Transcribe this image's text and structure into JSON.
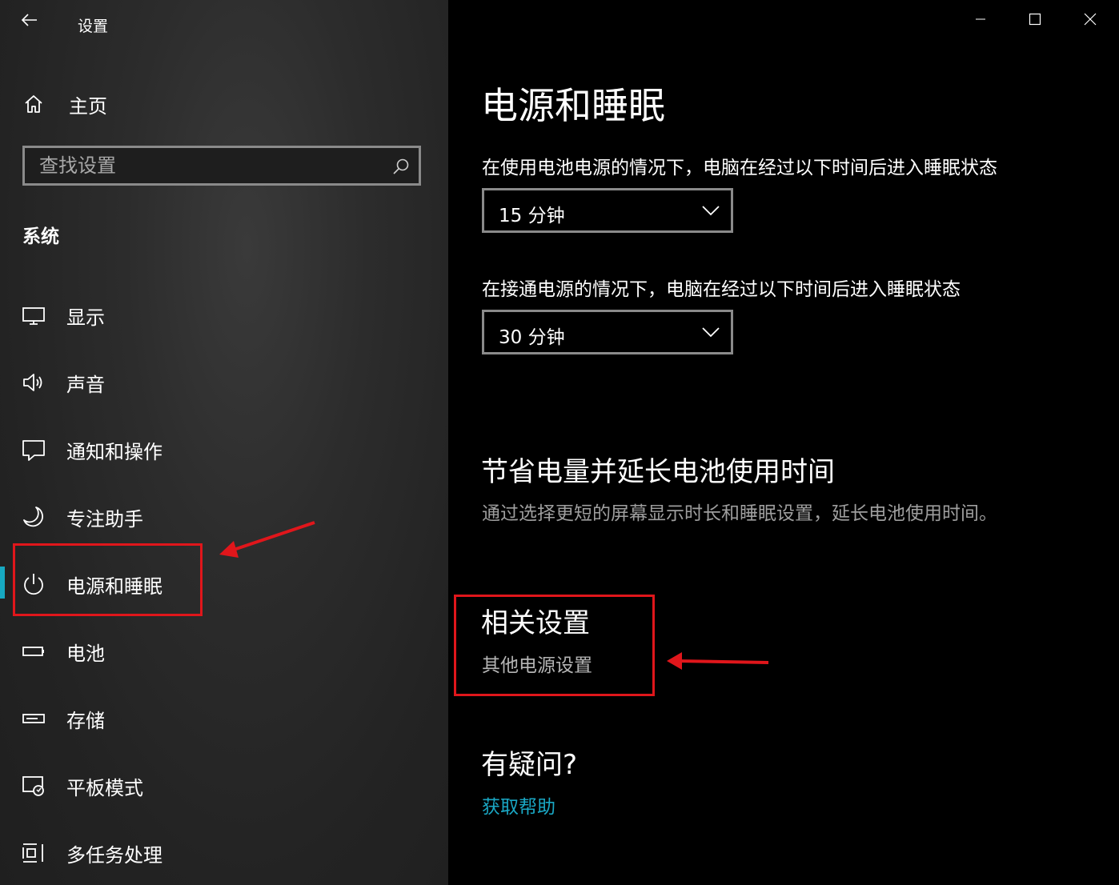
{
  "window": {
    "title": "设置",
    "controls": [
      "minimize",
      "maximize",
      "close"
    ]
  },
  "sidebar": {
    "home_label": "主页",
    "search": {
      "placeholder": "查找设置",
      "value": ""
    },
    "section": "系统",
    "items": [
      {
        "label": "显示",
        "icon": "monitor-icon"
      },
      {
        "label": "声音",
        "icon": "speaker-icon"
      },
      {
        "label": "通知和操作",
        "icon": "notification-icon"
      },
      {
        "label": "专注助手",
        "icon": "moon-icon"
      },
      {
        "label": "电源和睡眠",
        "icon": "power-icon",
        "selected": true
      },
      {
        "label": "电池",
        "icon": "battery-icon"
      },
      {
        "label": "存储",
        "icon": "storage-icon"
      },
      {
        "label": "平板模式",
        "icon": "tablet-mode-icon"
      },
      {
        "label": "多任务处理",
        "icon": "multitasking-icon"
      }
    ]
  },
  "main": {
    "title": "电源和睡眠",
    "battery_sleep": {
      "label": "在使用电池电源的情况下，电脑在经过以下时间后进入睡眠状态",
      "value": "15 分钟"
    },
    "plugged_sleep": {
      "label": "在接通电源的情况下，电脑在经过以下时间后进入睡眠状态",
      "value": "30 分钟"
    },
    "save_power": {
      "heading": "节省电量并延长电池使用时间",
      "description": "通过选择更短的屏幕显示时长和睡眠设置，延长电池使用时间。"
    },
    "related": {
      "heading": "相关设置",
      "link": "其他电源设置"
    },
    "help": {
      "heading": "有疑问?",
      "link": "获取帮助"
    }
  },
  "colors": {
    "accent": "#17a9c2",
    "link": "#1aa7c4",
    "annotation": "#e0161b",
    "sidebar_bg": "#2a2a2a",
    "main_bg": "#000000"
  }
}
